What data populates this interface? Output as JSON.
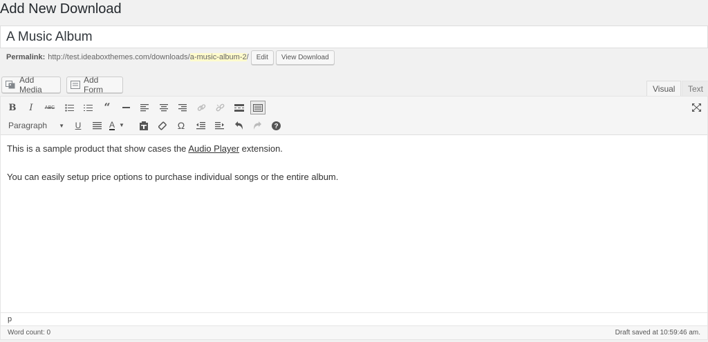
{
  "page": {
    "title": "Add New Download"
  },
  "post": {
    "title": "A Music Album"
  },
  "permalink": {
    "label": "Permalink:",
    "base_url": "http://test.ideaboxthemes.com/downloads/",
    "slug": "a-music-album-2",
    "trailing": "/",
    "edit_label": "Edit",
    "view_label": "View Download"
  },
  "media_buttons": {
    "add_media": "Add Media",
    "add_form": "Add Form"
  },
  "editor_tabs": {
    "visual": "Visual",
    "text": "Text"
  },
  "toolbar": {
    "format_select": "Paragraph",
    "icons": [
      "bold-icon",
      "italic-icon",
      "strikethrough-icon",
      "bullet-list-icon",
      "numbered-list-icon",
      "blockquote-icon",
      "horizontal-rule-icon",
      "align-left-icon",
      "align-center-icon",
      "align-right-icon",
      "link-icon",
      "unlink-icon",
      "read-more-icon",
      "toolbar-toggle-icon",
      "fullscreen-icon",
      "underline-icon",
      "justify-icon",
      "text-color-icon",
      "paste-text-icon",
      "clear-formatting-icon",
      "special-character-icon",
      "outdent-icon",
      "indent-icon",
      "undo-icon",
      "redo-icon",
      "help-icon"
    ]
  },
  "content": {
    "para1_before": "This is a sample product that show cases the ",
    "para1_link": "Audio Player",
    "para1_after": " extension.",
    "para2": "You can easily setup price options to purchase individual songs or the entire album."
  },
  "status": {
    "path": "p",
    "word_count": "Word count: 0",
    "draft_saved": "Draft saved at 10:59:46 am."
  }
}
